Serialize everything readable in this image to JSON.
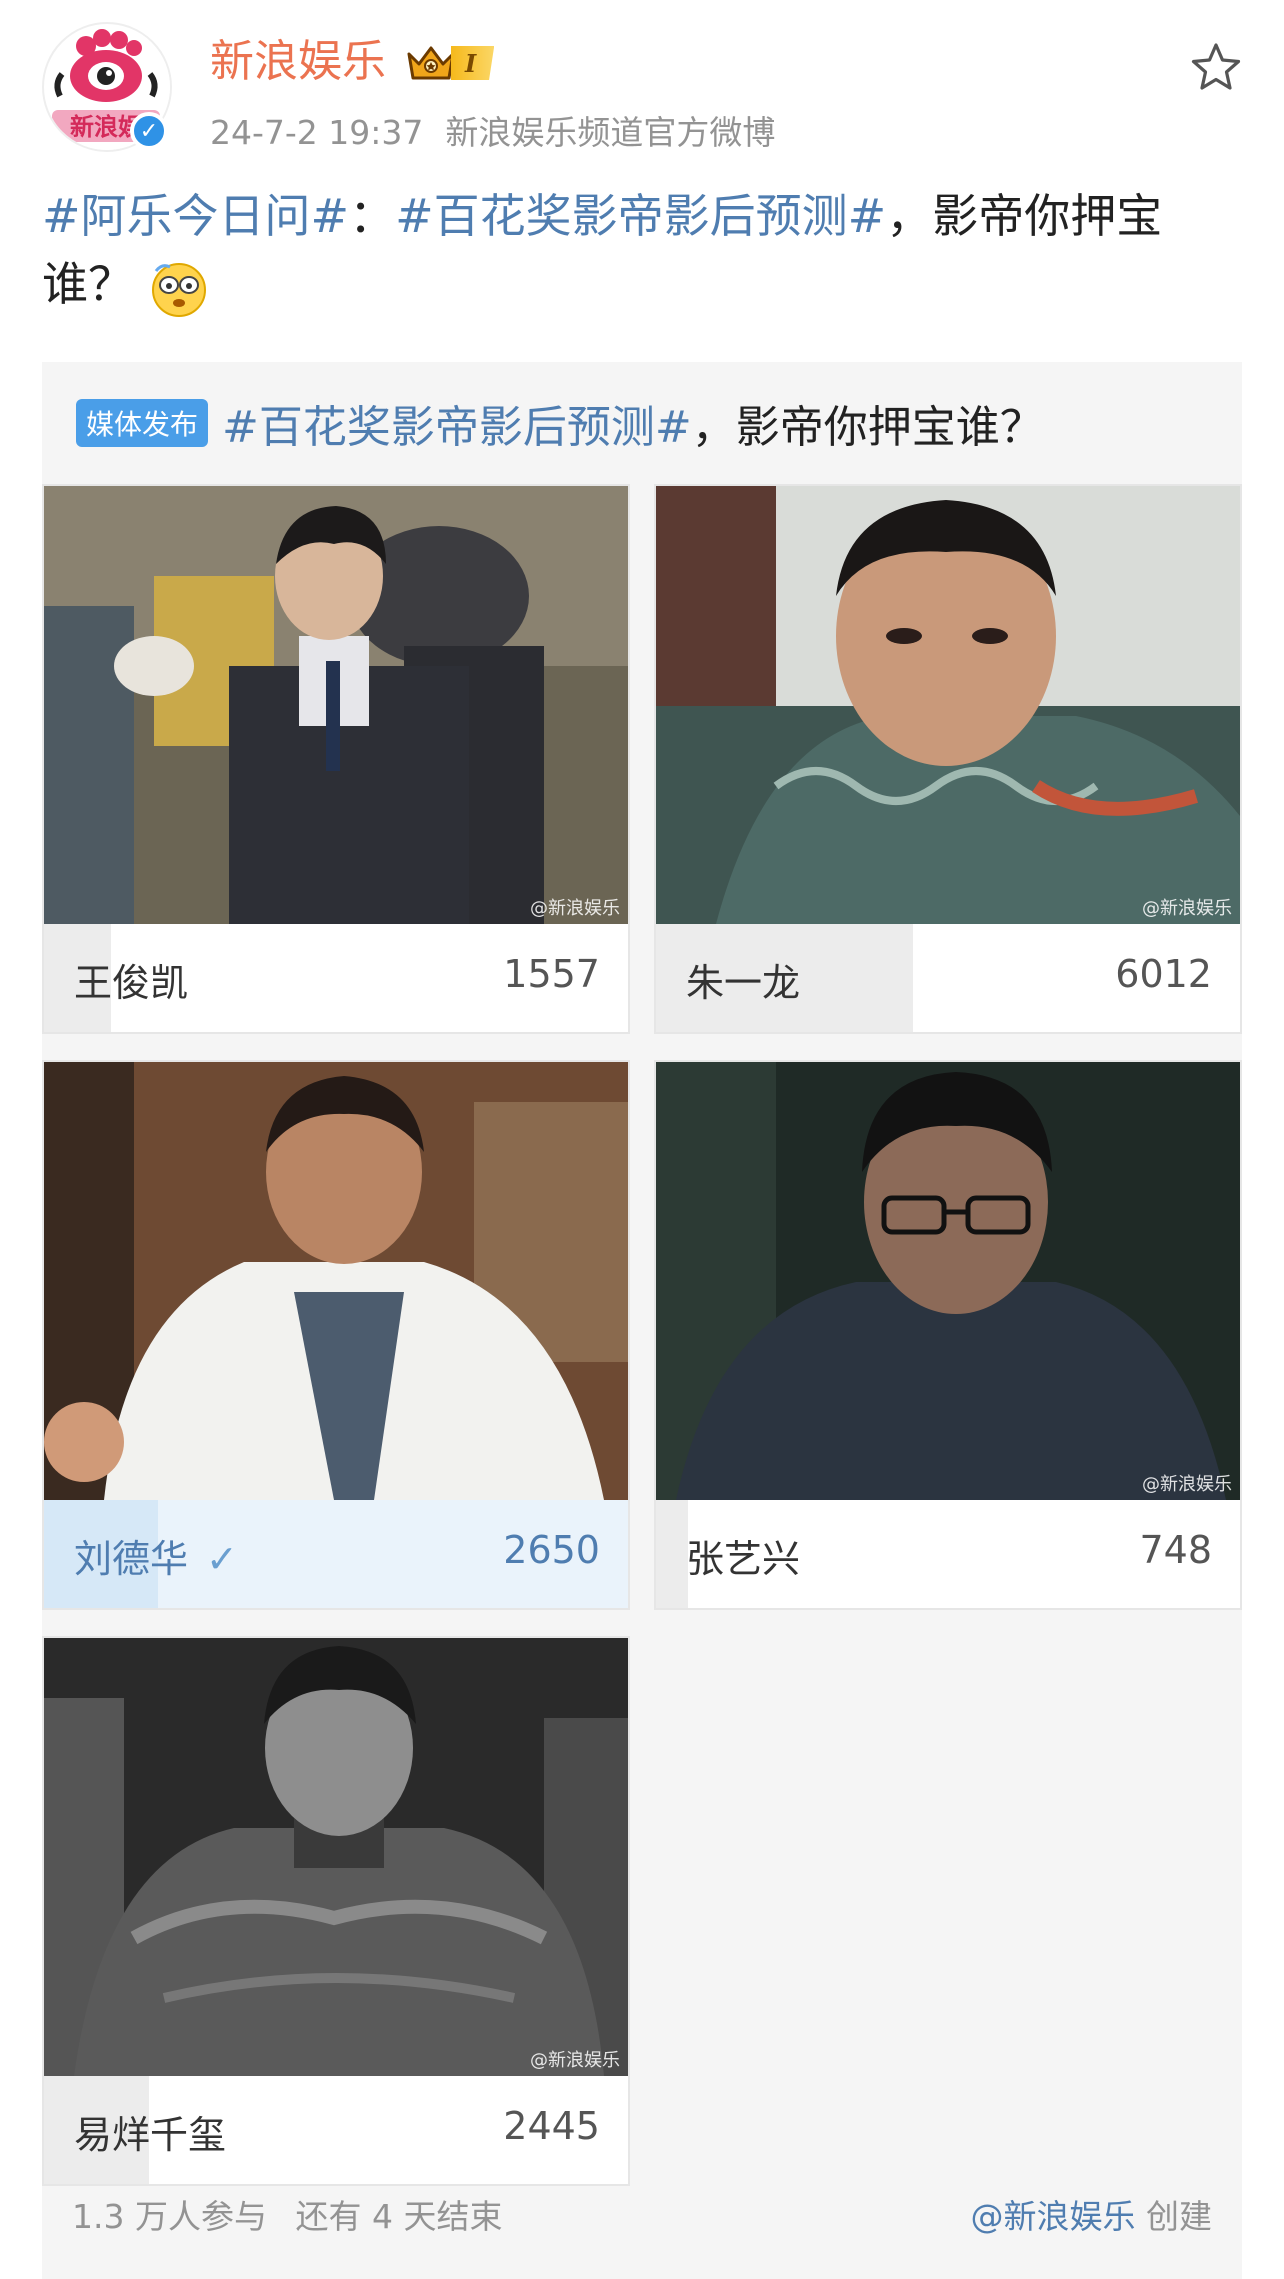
{
  "header": {
    "account_name": "新浪娱乐",
    "vip_level": "I",
    "date": "24-7-2 19:37",
    "description": "新浪娱乐频道官方微博",
    "avatar_text": "新浪娱",
    "verified": true
  },
  "post": {
    "hashtag1": "#阿乐今日问#",
    "sep1": "：",
    "hashtag2": "#百花奖影帝影后预测#",
    "text": "，影帝你押宝谁？"
  },
  "vote": {
    "media_tag": "媒体发布",
    "title_hashtag": "#百花奖影帝影后预测#",
    "title_text": "，影帝你押宝谁？",
    "watermark": "@新浪娱乐",
    "options": [
      {
        "name": "王俊凯",
        "count": "1557",
        "fraction": 0.115,
        "selected": false
      },
      {
        "name": "朱一龙",
        "count": "6012",
        "fraction": 0.44,
        "selected": false
      },
      {
        "name": "刘德华",
        "count": "2650",
        "fraction": 0.195,
        "selected": true
      },
      {
        "name": "张艺兴",
        "count": "748",
        "fraction": 0.055,
        "selected": false
      },
      {
        "name": "易烊千玺",
        "count": "2445",
        "fraction": 0.18,
        "selected": false
      }
    ],
    "participants": "1.3 万人参与",
    "remaining": "还有 4 天结束",
    "creator": "@新浪娱乐",
    "created_label": "创建"
  },
  "colors": {
    "brand_orange": "#eb7350",
    "link_blue": "#4f7db0",
    "tag_blue": "#4a9ee8",
    "verified_blue": "#2f92e6"
  }
}
